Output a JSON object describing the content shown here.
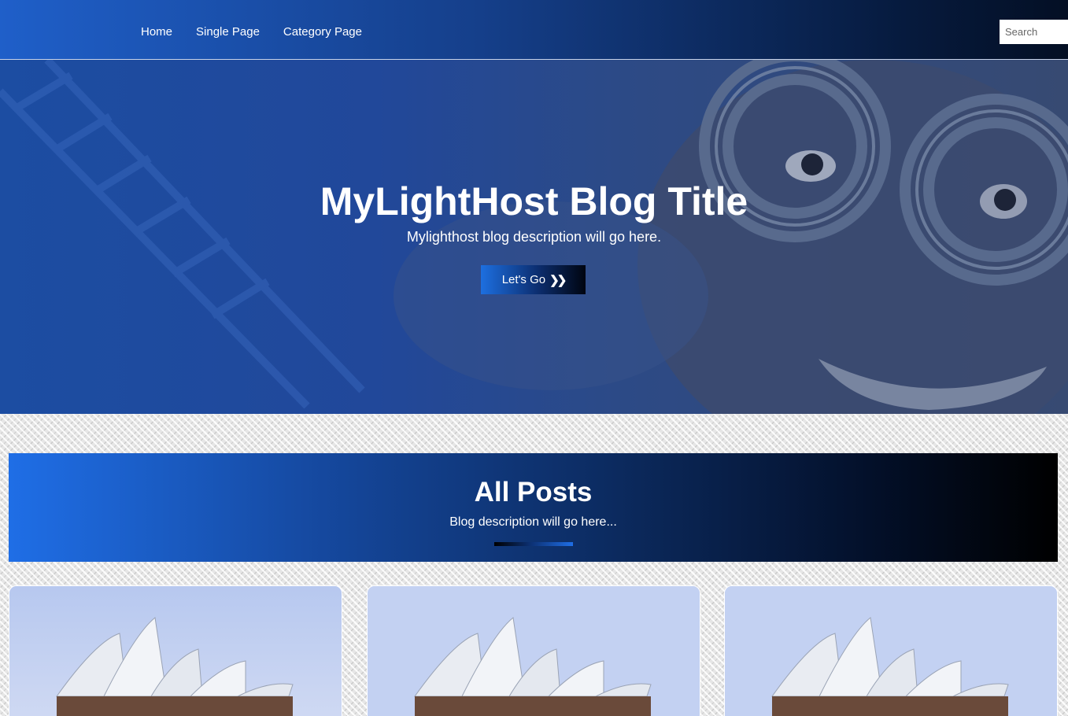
{
  "nav": {
    "items": [
      {
        "label": "Home"
      },
      {
        "label": "Single Page"
      },
      {
        "label": "Category Page"
      }
    ],
    "search_placeholder": "Search"
  },
  "hero": {
    "title": "MyLightHost Blog Title",
    "description": "Mylighthost blog description will go here.",
    "button_label": "Let's Go",
    "button_icon": "double-chevron-right-icon"
  },
  "posts_section": {
    "title": "All Posts",
    "description": "Blog description will go here..."
  },
  "posts": [
    {
      "image": "sydney-opera-house"
    },
    {
      "image": "sydney-opera-house"
    },
    {
      "image": "sydney-opera-house"
    }
  ],
  "colors": {
    "accent_blue": "#1f6ee6",
    "dark_navy": "#061a3d",
    "black": "#000000",
    "white": "#ffffff"
  }
}
